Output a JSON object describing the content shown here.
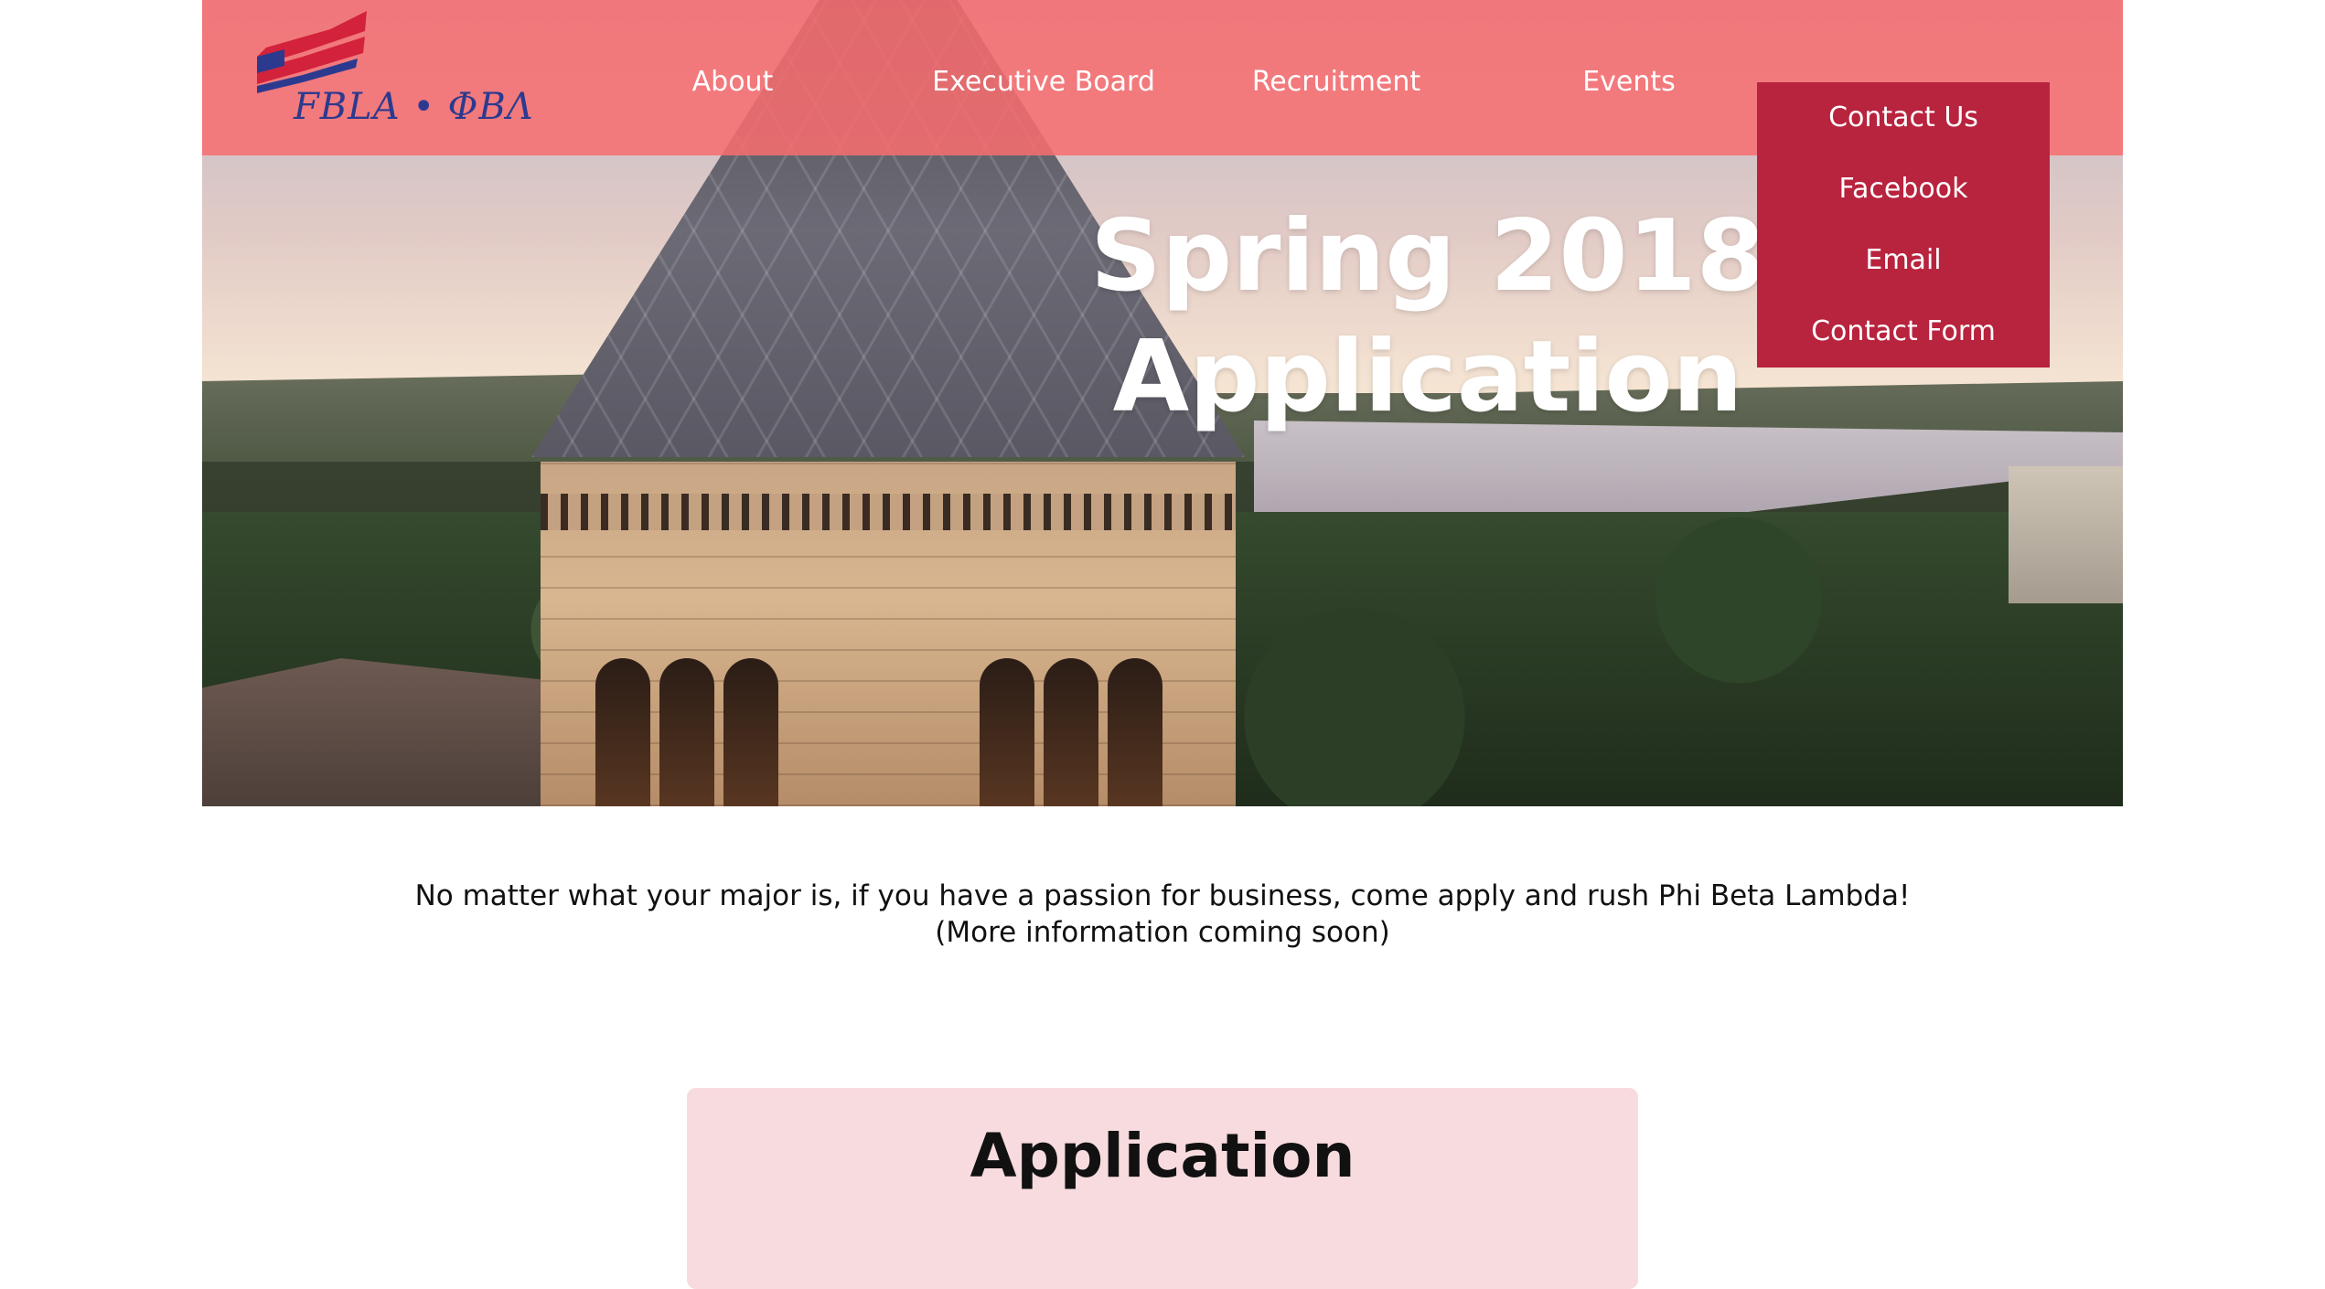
{
  "brand": {
    "logo_text": "FBLA • ΦΒΛ",
    "colors": {
      "nav_bg": "#f86d70",
      "dropdown_bg": "#b8233e",
      "card_bg": "#f8dbde",
      "logo_blue": "#2b3a8f",
      "logo_red": "#d3223b"
    }
  },
  "nav": {
    "items": [
      "About",
      "Executive Board",
      "Recruitment",
      "Events"
    ],
    "contact": {
      "label": "Contact Us",
      "submenu": [
        "Facebook",
        "Email",
        "Contact Form"
      ]
    }
  },
  "hero": {
    "title_line1": "Spring 2018",
    "title_line2": "Application"
  },
  "intro": {
    "line1": "No matter what your major is, if you have a passion for business, come apply and rush Phi Beta Lambda!",
    "line2": "(More information coming soon)"
  },
  "application_card": {
    "heading": "Application"
  }
}
